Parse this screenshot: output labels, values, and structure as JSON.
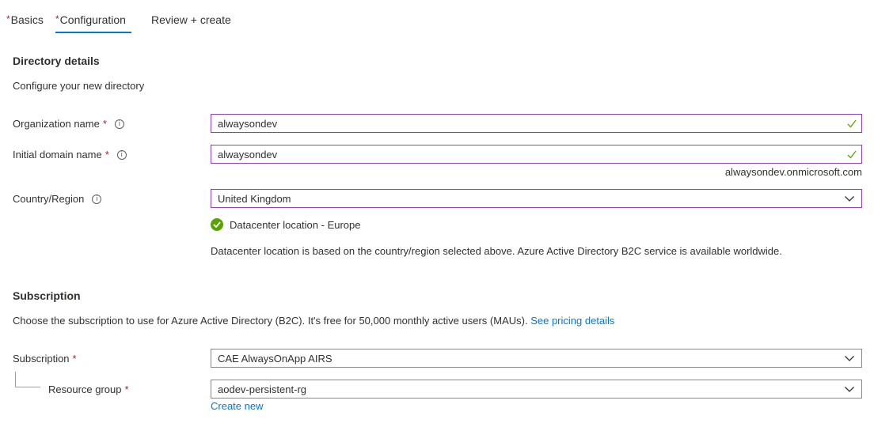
{
  "tabs": [
    {
      "label": "Basics",
      "required": "*"
    },
    {
      "label": "Configuration",
      "required": "*"
    },
    {
      "label": "Review + create"
    }
  ],
  "directory": {
    "title": "Directory details",
    "description": "Configure your new directory",
    "org_name": {
      "label": "Organization name",
      "required": "*",
      "value": "alwaysondev"
    },
    "domain_name": {
      "label": "Initial domain name",
      "required": "*",
      "value": "alwaysondev",
      "suffix": "alwaysondev.onmicrosoft.com"
    },
    "country": {
      "label": "Country/Region",
      "value": "United Kingdom"
    },
    "datacenter_status": "Datacenter location - Europe",
    "datacenter_note": "Datacenter location is based on the country/region selected above. Azure Active Directory B2C service is available worldwide."
  },
  "subscription_section": {
    "title": "Subscription",
    "description": "Choose the subscription to use for Azure Active Directory (B2C). It's free for 50,000 monthly active users (MAUs).",
    "pricing_link": "See pricing details",
    "subscription": {
      "label": "Subscription",
      "required": "*",
      "value": "CAE AlwaysOnApp AIRS"
    },
    "resource_group": {
      "label": "Resource group",
      "required": "*",
      "value": "aodev-persistent-rg"
    },
    "create_new_link": "Create new"
  },
  "icons": {
    "info": "info-icon",
    "check": "checkmark-icon",
    "chevron": "chevron-down-icon",
    "success": "success-check-icon"
  },
  "colors": {
    "accent": "#0078d4",
    "required": "#a4262c",
    "valid_border": "#8e44ad",
    "success": "#57a300"
  }
}
